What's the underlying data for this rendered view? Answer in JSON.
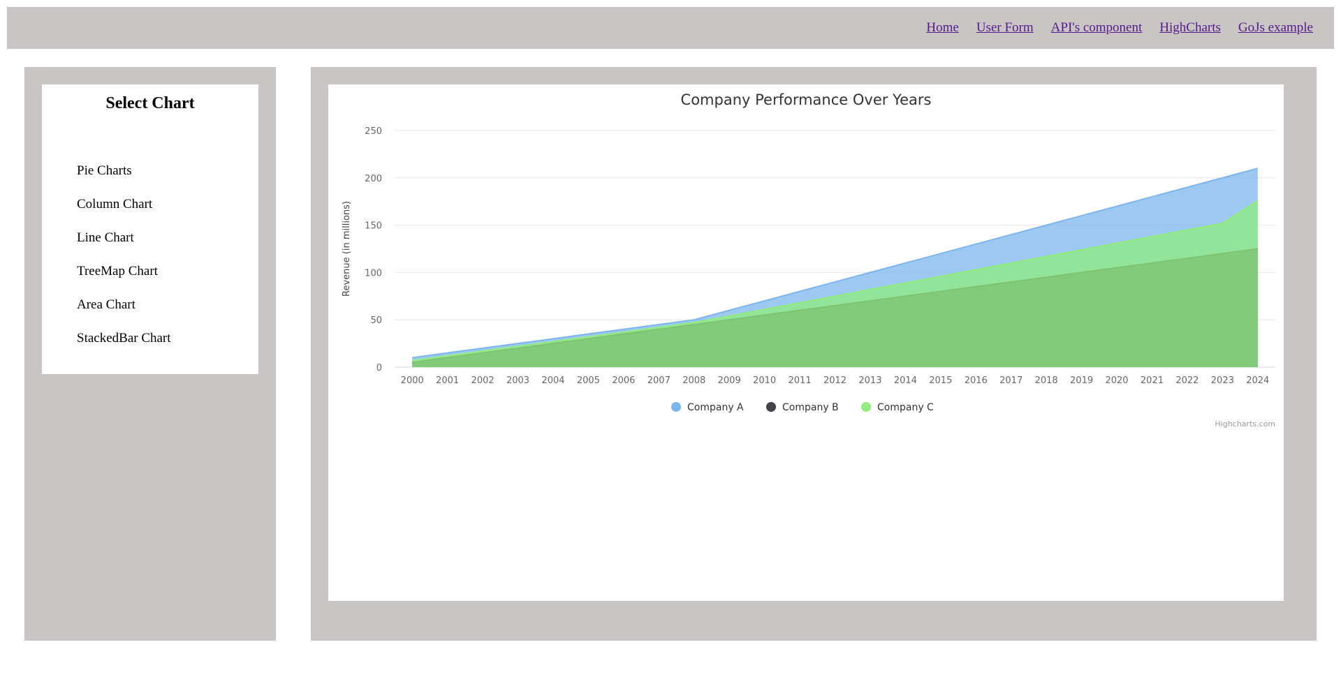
{
  "nav": {
    "links": [
      "Home",
      "User Form",
      "API's component",
      "HighCharts",
      "GoJs example"
    ]
  },
  "sidebar": {
    "title": "Select Chart",
    "items": [
      "Pie Charts",
      "Column Chart",
      "Line Chart",
      "TreeMap Chart",
      "Area Chart",
      "StackedBar Chart"
    ]
  },
  "chart_data": {
    "type": "area",
    "title": "Company Performance Over Years",
    "ylabel": "Revenue (in millions)",
    "xlabel": "",
    "ylim": [
      0,
      250
    ],
    "yticks": [
      0,
      50,
      100,
      150,
      200,
      250
    ],
    "grid": true,
    "legend_position": "bottom-center",
    "credits": "Highcharts.com",
    "categories": [
      "2000",
      "2001",
      "2002",
      "2003",
      "2004",
      "2005",
      "2006",
      "2007",
      "2008",
      "2009",
      "2010",
      "2011",
      "2012",
      "2013",
      "2014",
      "2015",
      "2016",
      "2017",
      "2018",
      "2019",
      "2020",
      "2021",
      "2022",
      "2023",
      "2024"
    ],
    "series": [
      {
        "name": "Company A",
        "color": "#7cb5ec",
        "values": [
          10,
          15,
          20,
          25,
          30,
          35,
          40,
          45,
          50,
          60,
          70,
          80,
          90,
          100,
          110,
          120,
          130,
          140,
          150,
          160,
          170,
          180,
          190,
          200,
          210
        ]
      },
      {
        "name": "Company B",
        "color": "#434348",
        "values": [
          5,
          10,
          15,
          20,
          25,
          30,
          35,
          40,
          45,
          50,
          55,
          60,
          65,
          70,
          75,
          80,
          85,
          90,
          95,
          100,
          105,
          110,
          115,
          120,
          125
        ]
      },
      {
        "name": "Company C",
        "color": "#90ed7d",
        "values": [
          7,
          12,
          17,
          22,
          27,
          32,
          37,
          42,
          47,
          54,
          61,
          68,
          75,
          82,
          89,
          96,
          103,
          110,
          117,
          124,
          131,
          138,
          145,
          152,
          176
        ]
      }
    ]
  }
}
